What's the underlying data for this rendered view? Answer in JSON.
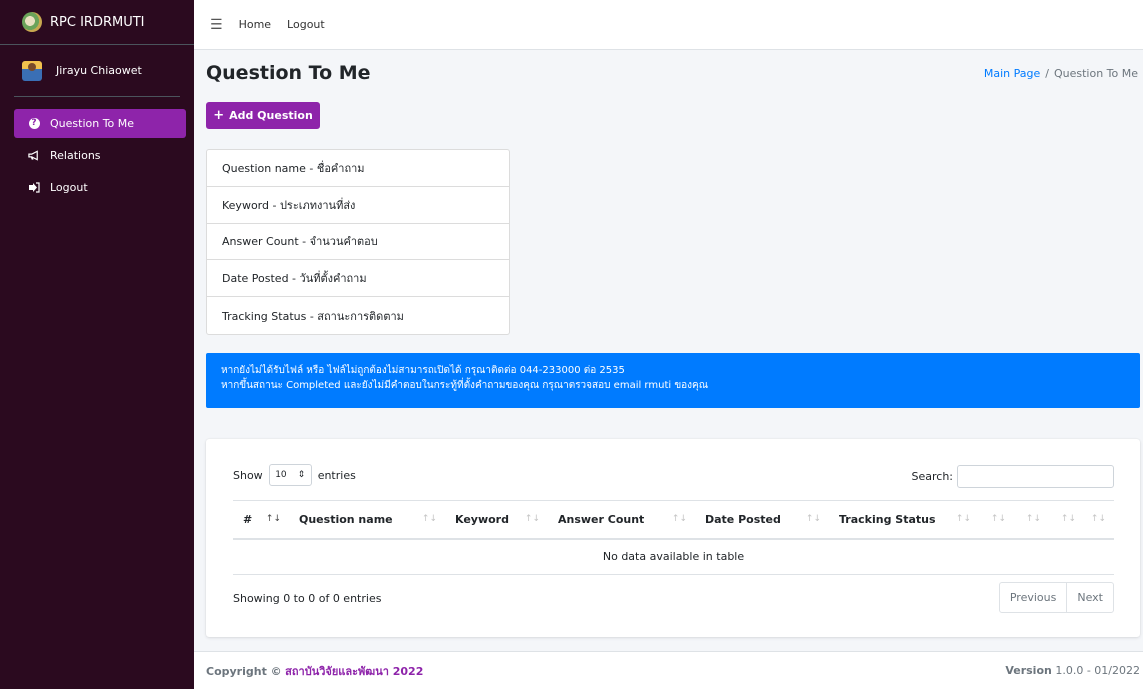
{
  "sidebar": {
    "brand": "RPC IRDRMUTI",
    "user": "Jirayu Chiaowet",
    "items": [
      {
        "label": "Question To Me",
        "icon": "question-circle-icon",
        "active": true
      },
      {
        "label": "Relations",
        "icon": "bullhorn-icon",
        "active": false
      },
      {
        "label": "Logout",
        "icon": "sign-out-icon",
        "active": false
      }
    ]
  },
  "topnav": {
    "home": "Home",
    "logout": "Logout"
  },
  "page": {
    "title": "Question To Me",
    "breadcrumb": {
      "main": "Main Page",
      "separator": "/",
      "current": "Question To Me"
    },
    "add_button": "Add Question"
  },
  "info_list": [
    "Question name - ชื่อคำถาม",
    "Keyword - ประเภทงานที่ส่ง",
    "Answer Count - จำนวนคำตอบ",
    "Date Posted - วันที่ตั้งคำถาม",
    "Tracking Status - สถานะการติดตาม"
  ],
  "alert": {
    "line1": "หากยังไม่ได้รับไฟล์ หรือ ไฟล์ไม่ถูกต้องไม่สามารถเปิดได้ กรุณาติดต่อ 044-233000 ต่อ 2535",
    "line2": "หากขึ้นสถานะ Completed และยังไม่มีคำตอบในกระทู้ที่ตั้งคำถามของคุณ กรุณาตรวจสอบ email rmuti ของคุณ"
  },
  "table": {
    "show": "Show",
    "entries_value": "10",
    "entries": "entries",
    "search_label": "Search:",
    "columns": [
      "#",
      "Question name",
      "Keyword",
      "Answer Count",
      "Date Posted",
      "Tracking Status",
      "",
      "",
      "",
      ""
    ],
    "empty": "No data available in table",
    "info": "Showing 0 to 0 of 0 entries",
    "prev": "Previous",
    "next": "Next"
  },
  "footer": {
    "copyright": "Copyright ©",
    "org": "สถาบันวิจัยและพัฒนา 2022",
    "version_label": "Version",
    "version": "1.0.0 - 01/2022"
  },
  "colors": {
    "accent": "#8e24aa",
    "sidebar": "#2b0a1f",
    "alert": "#007bff"
  }
}
